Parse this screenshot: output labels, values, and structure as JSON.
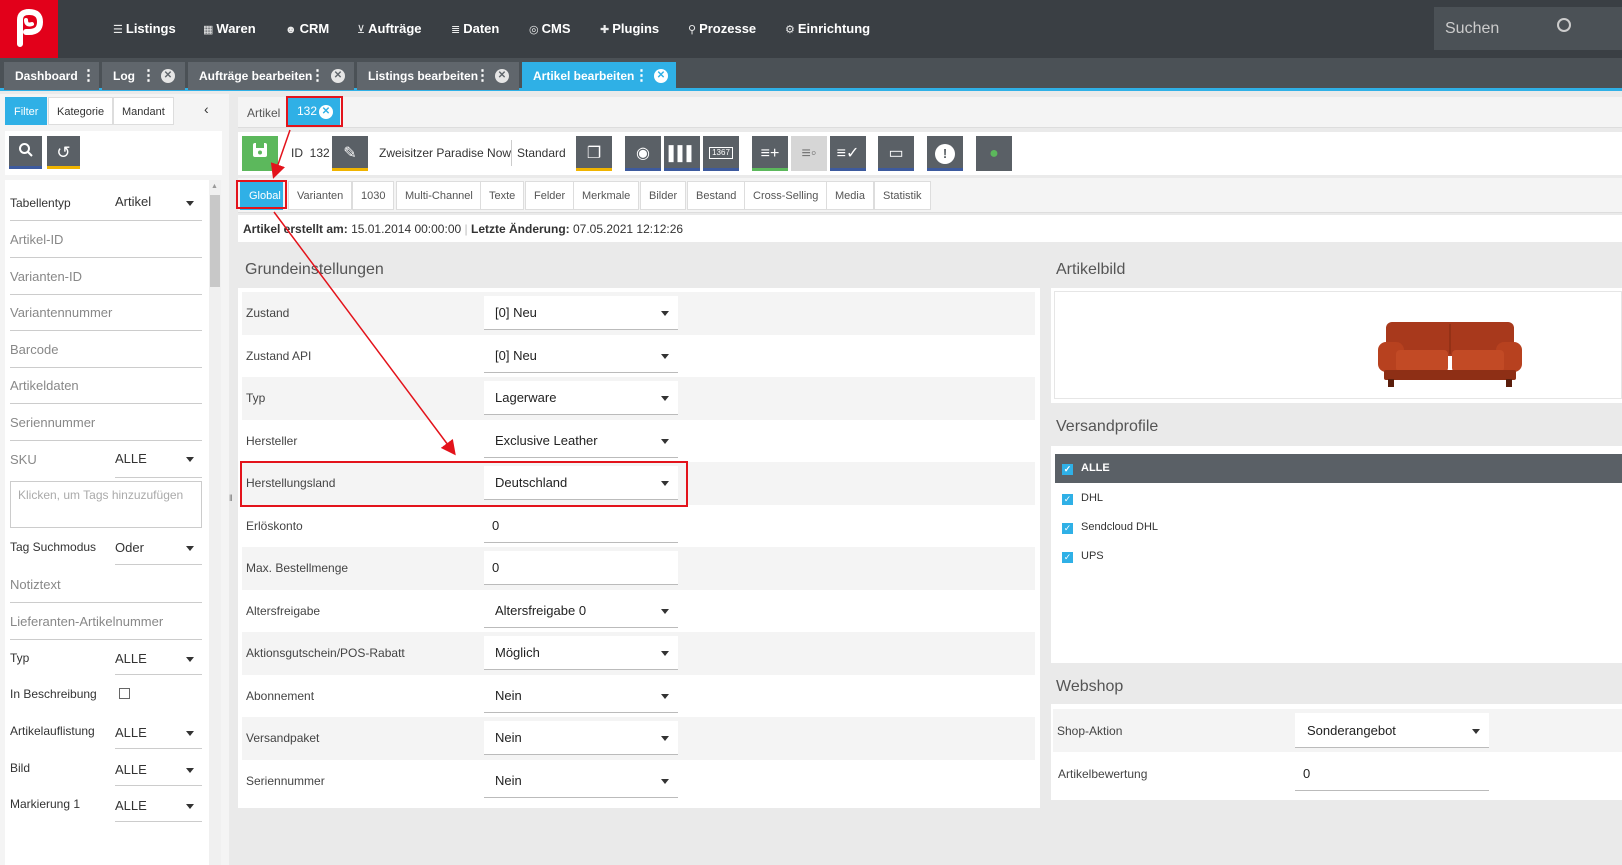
{
  "nav": {
    "items": [
      {
        "label": "Listings",
        "icon": "list-icon"
      },
      {
        "label": "Waren",
        "icon": "box-icon"
      },
      {
        "label": "CRM",
        "icon": "users-icon"
      },
      {
        "label": "Aufträge",
        "icon": "cart-icon"
      },
      {
        "label": "Daten",
        "icon": "database-icon"
      },
      {
        "label": "CMS",
        "icon": "globe-icon"
      },
      {
        "label": "Plugins",
        "icon": "puzzle-icon"
      },
      {
        "label": "Prozesse",
        "icon": "process-icon"
      },
      {
        "label": "Einrichtung",
        "icon": "gear-icon"
      }
    ],
    "search_placeholder": "Suchen"
  },
  "tabs": [
    "Dashboard",
    "Log",
    "Aufträge bearbeiten",
    "Listings bearbeiten",
    "Artikel bearbeiten"
  ],
  "left": {
    "tabs": [
      "Filter",
      "Kategorie",
      "Mandant"
    ],
    "fields": {
      "tabellentyp_label": "Tabellentyp",
      "tabellentyp_value": "Artikel",
      "artikel_id": "Artikel-ID",
      "varianten_id": "Varianten-ID",
      "variantennummer": "Variantennummer",
      "barcode": "Barcode",
      "artikeldaten": "Artikeldaten",
      "seriennummer": "Seriennummer",
      "sku_label": "SKU",
      "sku_value": "ALLE",
      "tags_placeholder": "Klicken, um Tags hinzuzufügen",
      "tag_suchmodus_label": "Tag Suchmodus",
      "tag_suchmodus_value": "Oder",
      "notiztext": "Notiztext",
      "lieferanten": "Lieferanten-Artikelnummer",
      "typ_label": "Typ",
      "typ_value": "ALLE",
      "in_beschreibung": "In Beschreibung",
      "artikelauflistung_label": "Artikelauflistung",
      "artikelauflistung_value": "ALLE",
      "bild_label": "Bild",
      "bild_value": "ALLE",
      "markierung_label": "Markierung 1",
      "markierung_value": "ALLE"
    }
  },
  "breadcrumb": {
    "artikel": "Artikel",
    "id": "132"
  },
  "toolbar": {
    "id_label": "ID",
    "id_value": "132",
    "name": "Zweisitzer Paradise Now",
    "variant": "Standard",
    "barcode_badge": "1367"
  },
  "subtabs": [
    "Global",
    "Varianten",
    "1030",
    "Multi-Channel",
    "Texte",
    "Felder",
    "Merkmale",
    "Bilder",
    "Bestand",
    "Cross-Selling",
    "Media",
    "Statistik"
  ],
  "meta": {
    "created_label": "Artikel erstellt am:",
    "created_value": "15.01.2014 00:00:00",
    "changed_label": "Letzte Änderung:",
    "changed_value": "07.05.2021 12:12:26"
  },
  "grund": {
    "title": "Grundeinstellungen",
    "rows": [
      {
        "label": "Zustand",
        "value": "[0] Neu"
      },
      {
        "label": "Zustand API",
        "value": "[0] Neu"
      },
      {
        "label": "Typ",
        "value": "Lagerware"
      },
      {
        "label": "Hersteller",
        "value": "Exclusive Leather"
      },
      {
        "label": "Herstellungsland",
        "value": "Deutschland"
      },
      {
        "label": "Erlöskonto",
        "value": "0"
      },
      {
        "label": "Max. Bestellmenge",
        "value": "0"
      },
      {
        "label": "Altersfreigabe",
        "value": "Altersfreigabe 0"
      },
      {
        "label": "Aktionsgutschein/POS-Rabatt",
        "value": "Möglich"
      },
      {
        "label": "Abonnement",
        "value": "Nein"
      },
      {
        "label": "Versandpaket",
        "value": "Nein"
      },
      {
        "label": "Seriennummer",
        "value": "Nein"
      }
    ]
  },
  "artikelbild_title": "Artikelbild",
  "versand": {
    "title": "Versandprofile",
    "all": "ALLE",
    "items": [
      "DHL",
      "Sendcloud DHL",
      "UPS"
    ]
  },
  "webshop": {
    "title": "Webshop",
    "shop_aktion_label": "Shop-Aktion",
    "shop_aktion_value": "Sonderangebot",
    "bewertung_label": "Artikelbewertung",
    "bewertung_value": "0"
  },
  "colors": {
    "accent": "#2fb0e6",
    "brand": "#e2001a",
    "topbar": "#3a3f44",
    "annotation": "#e3131b"
  }
}
